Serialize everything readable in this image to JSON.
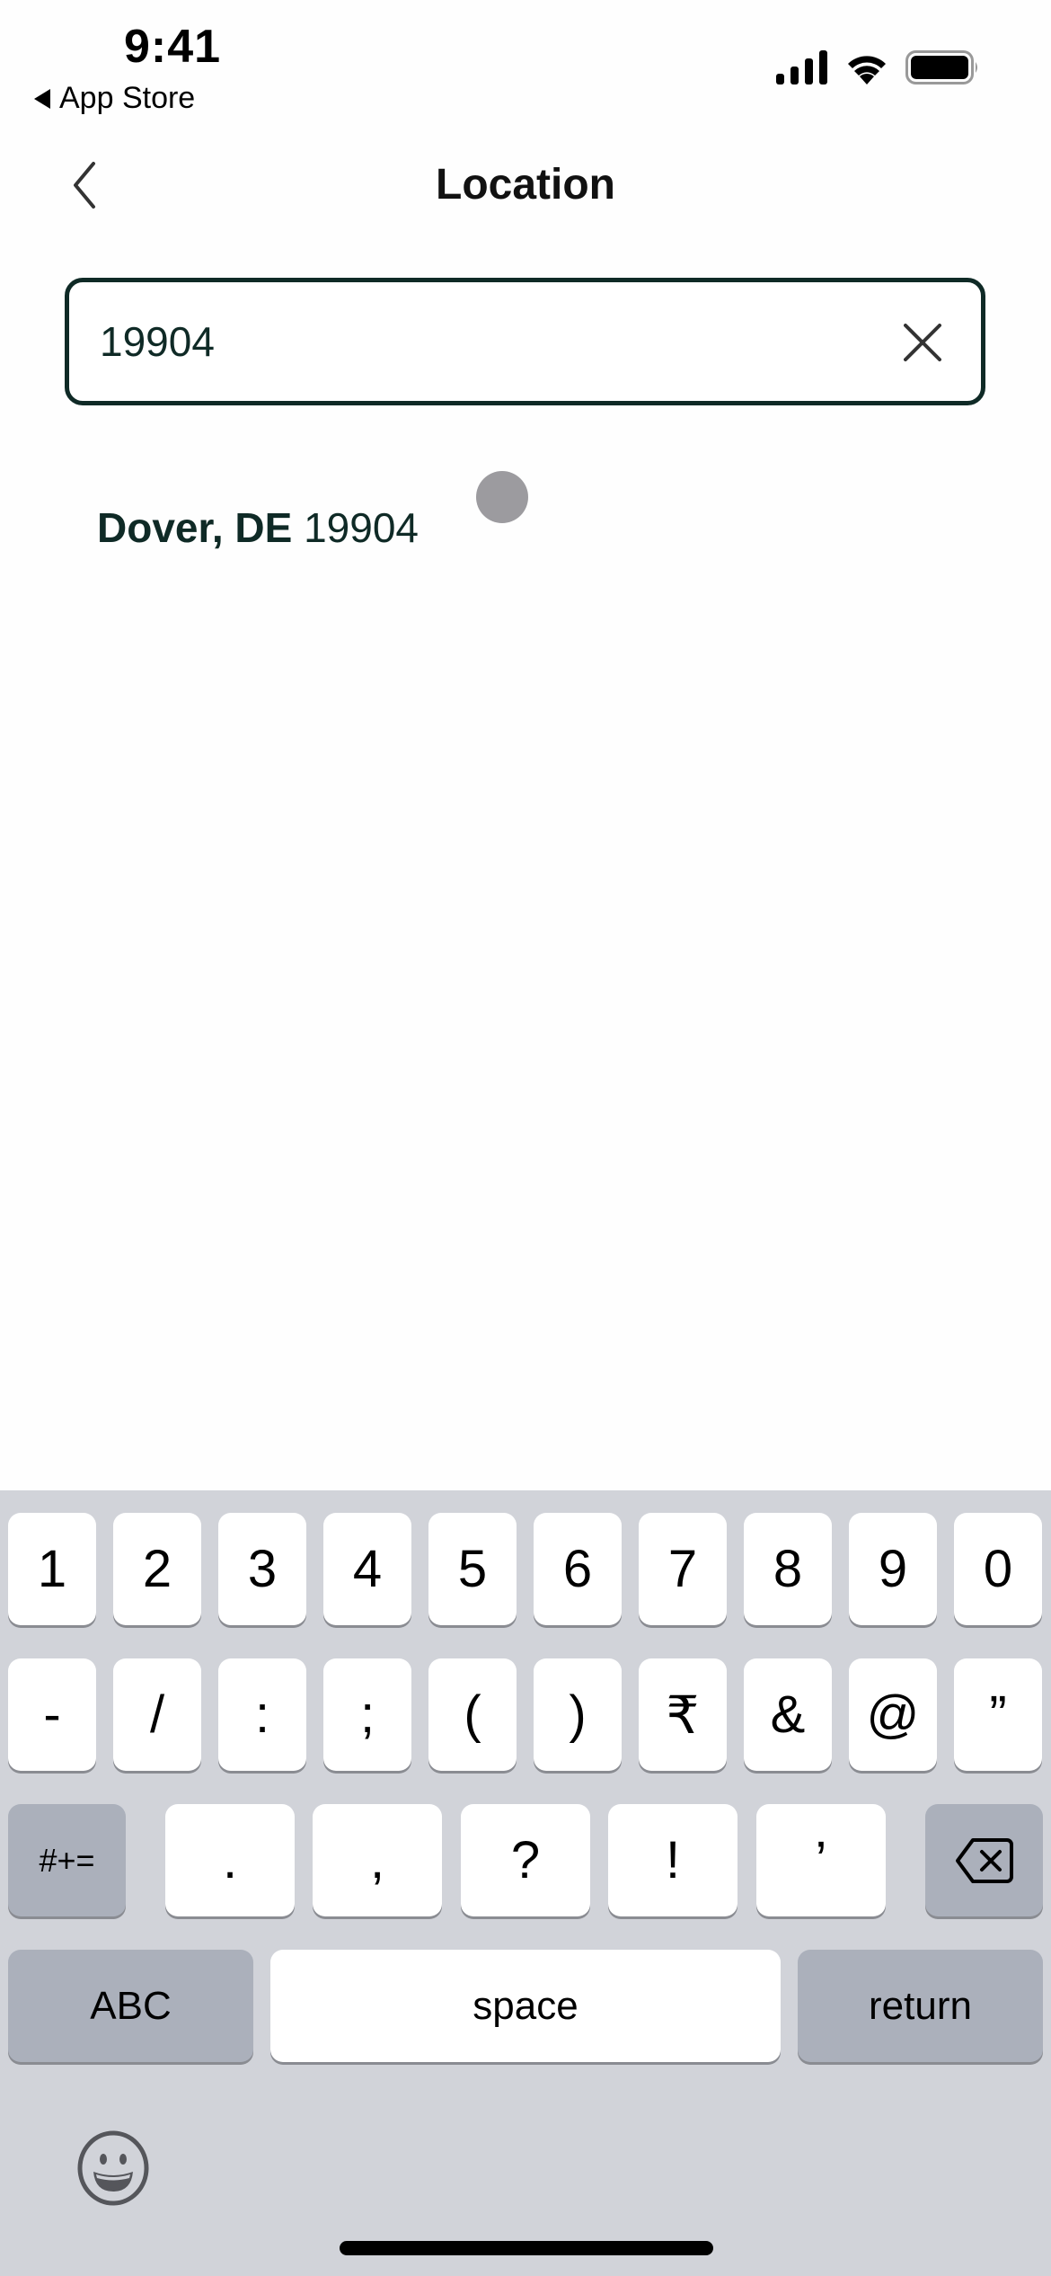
{
  "status_bar": {
    "time": "9:41",
    "back_app_label": "App Store",
    "icons": [
      "cellular-signal-icon",
      "wifi-icon",
      "battery-icon"
    ]
  },
  "nav": {
    "title": "Location",
    "back_icon": "chevron-left-icon"
  },
  "search": {
    "value": "19904",
    "clear_icon": "close-icon"
  },
  "results": [
    {
      "city": "Dover, DE",
      "zip": "19904"
    }
  ],
  "keyboard": {
    "row1": [
      "1",
      "2",
      "3",
      "4",
      "5",
      "6",
      "7",
      "8",
      "9",
      "0"
    ],
    "row2": [
      "-",
      "/",
      ":",
      ";",
      "(",
      ")",
      "₹",
      "&",
      "@",
      "”"
    ],
    "row3_left": "#+=",
    "row3": [
      ".",
      ",",
      "?",
      "!",
      "’"
    ],
    "row3_right_icon": "backspace-icon",
    "abc_label": "ABC",
    "space_label": "space",
    "return_label": "return",
    "emoji_icon": "emoji-icon"
  }
}
